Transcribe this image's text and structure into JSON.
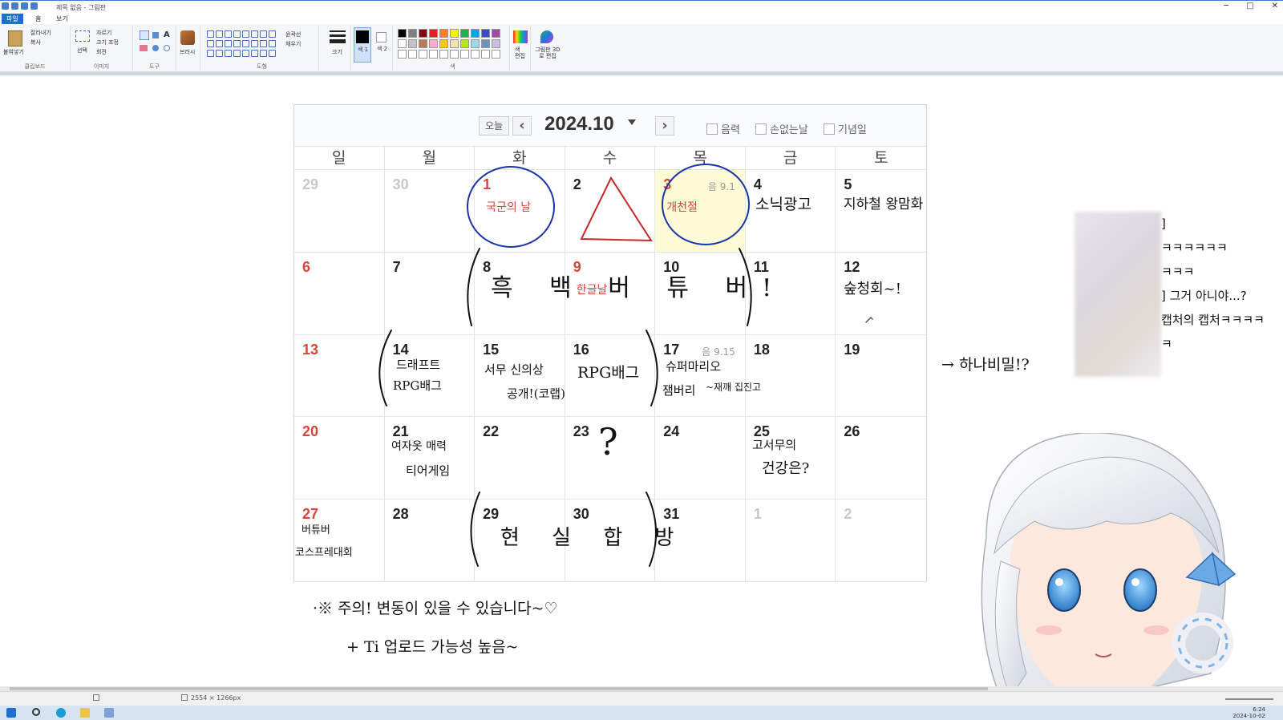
{
  "window": {
    "title": "제목 없음 - 그림판",
    "minimize_glyph": "─",
    "maximize_glyph": "□",
    "close_glyph": "✕"
  },
  "menu_tabs": [
    {
      "label": "파일",
      "active": true
    },
    {
      "label": "홈",
      "active": false
    },
    {
      "label": "보기",
      "active": false
    }
  ],
  "ribbon": {
    "clipboard": {
      "paste": "붙여넣기",
      "cut": "잘라내기",
      "copy": "복사",
      "group": "클립보드"
    },
    "image": {
      "select": "선택",
      "crop": "자르기",
      "resize": "크기 조정",
      "rotate": "회전",
      "group": "이미지"
    },
    "tools": {
      "group": "도구",
      "text_glyph": "A"
    },
    "brushes": {
      "label": "브러시"
    },
    "shapes": {
      "outline": "윤곽선",
      "fill": "채우기",
      "group": "도형"
    },
    "size": {
      "label": "크기"
    },
    "color1": {
      "label": "색 1"
    },
    "color2": {
      "label": "색 2"
    },
    "colors_group": "색",
    "edit_colors": "색 편집",
    "paint3d": "그림판 3D로 편집",
    "palette": [
      "#000000",
      "#7f7f7f",
      "#880015",
      "#ed1c24",
      "#ff7f27",
      "#fff200",
      "#22b14c",
      "#00a2e8",
      "#3f48cc",
      "#a349a4",
      "#ffffff",
      "#c3c3c3",
      "#b97a57",
      "#ffaec9",
      "#ffc90e",
      "#efe4b0",
      "#b5e61d",
      "#99d9ea",
      "#7092be",
      "#c8bfe7"
    ]
  },
  "calendar": {
    "today_label": "오늘",
    "prev_glyph": "‹",
    "next_glyph": "›",
    "month": "2024.10",
    "checks": [
      "음력",
      "손없는날",
      "기념일"
    ],
    "weekdays": [
      "일",
      "월",
      "화",
      "수",
      "목",
      "금",
      "토"
    ],
    "cells": [
      {
        "day": "29",
        "kind": "other"
      },
      {
        "day": "30",
        "kind": "other"
      },
      {
        "day": "1",
        "kind": "hol",
        "holiday": "국군의 날"
      },
      {
        "day": "2",
        "kind": "normal"
      },
      {
        "day": "3",
        "kind": "hol",
        "holiday": "개천절",
        "lunar": "음 9.1",
        "highlight": true
      },
      {
        "day": "4",
        "kind": "normal"
      },
      {
        "day": "5",
        "kind": "normal"
      },
      {
        "day": "6",
        "kind": "sun"
      },
      {
        "day": "7",
        "kind": "normal"
      },
      {
        "day": "8",
        "kind": "normal"
      },
      {
        "day": "9",
        "kind": "hol",
        "holiday": "한글날"
      },
      {
        "day": "10",
        "kind": "normal"
      },
      {
        "day": "11",
        "kind": "normal"
      },
      {
        "day": "12",
        "kind": "normal"
      },
      {
        "day": "13",
        "kind": "sun"
      },
      {
        "day": "14",
        "kind": "normal"
      },
      {
        "day": "15",
        "kind": "normal"
      },
      {
        "day": "16",
        "kind": "normal"
      },
      {
        "day": "17",
        "kind": "normal",
        "lunar": "음 9.15"
      },
      {
        "day": "18",
        "kind": "normal"
      },
      {
        "day": "19",
        "kind": "normal"
      },
      {
        "day": "20",
        "kind": "sun"
      },
      {
        "day": "21",
        "kind": "normal"
      },
      {
        "day": "22",
        "kind": "normal"
      },
      {
        "day": "23",
        "kind": "normal"
      },
      {
        "day": "24",
        "kind": "normal"
      },
      {
        "day": "25",
        "kind": "normal"
      },
      {
        "day": "26",
        "kind": "normal"
      },
      {
        "day": "27",
        "kind": "sun"
      },
      {
        "day": "28",
        "kind": "normal"
      },
      {
        "day": "29",
        "kind": "normal"
      },
      {
        "day": "30",
        "kind": "normal"
      },
      {
        "day": "31",
        "kind": "normal"
      },
      {
        "day": "1",
        "kind": "other"
      },
      {
        "day": "2",
        "kind": "other"
      }
    ]
  },
  "handwriting": {
    "oct4": "소닉광고",
    "oct5": "지하철 왕맘화",
    "week2": "흑 백 버 튜 버!",
    "oct12": "숲청회~!",
    "oct14_l1": "드래프트",
    "oct14_l2": "RPG배그",
    "oct15_l1": "서무 신의상",
    "oct15_l2": "공개!(코랩)",
    "oct16": "RPG배그",
    "oct17_l1": "슈퍼마리오",
    "oct17_l2": "잼버리",
    "oct17_l3": "~재깨 집진고",
    "oct21_l1": "여자옷 매력",
    "oct21_l2": "티어게임",
    "oct23": "?",
    "oct25_l1": "고서무의",
    "oct25_l2": "건강은?",
    "oct27_l1": "버튜버",
    "oct27_l2": "코스프레대회",
    "week5": "현 실 합 방",
    "arrow_note": "→ 하나비밀!?",
    "footer_1": "·※ 주의! 변동이 있을 수 있습니다~♡",
    "footer_2": "+ Ti 업로드 가능성 높음~"
  },
  "chat": [
    "]",
    "ㅋㅋㅋㅋㅋㅋ",
    "ㅋㅋㅋ",
    "] 그거 아니야...?",
    "캡처의 캡처ㅋㅋㅋㅋ",
    "ㅋ"
  ],
  "status": {
    "dimensions": "2554 × 1266px"
  },
  "taskbar": {
    "time": "6:24",
    "date": "2024-10-02"
  }
}
